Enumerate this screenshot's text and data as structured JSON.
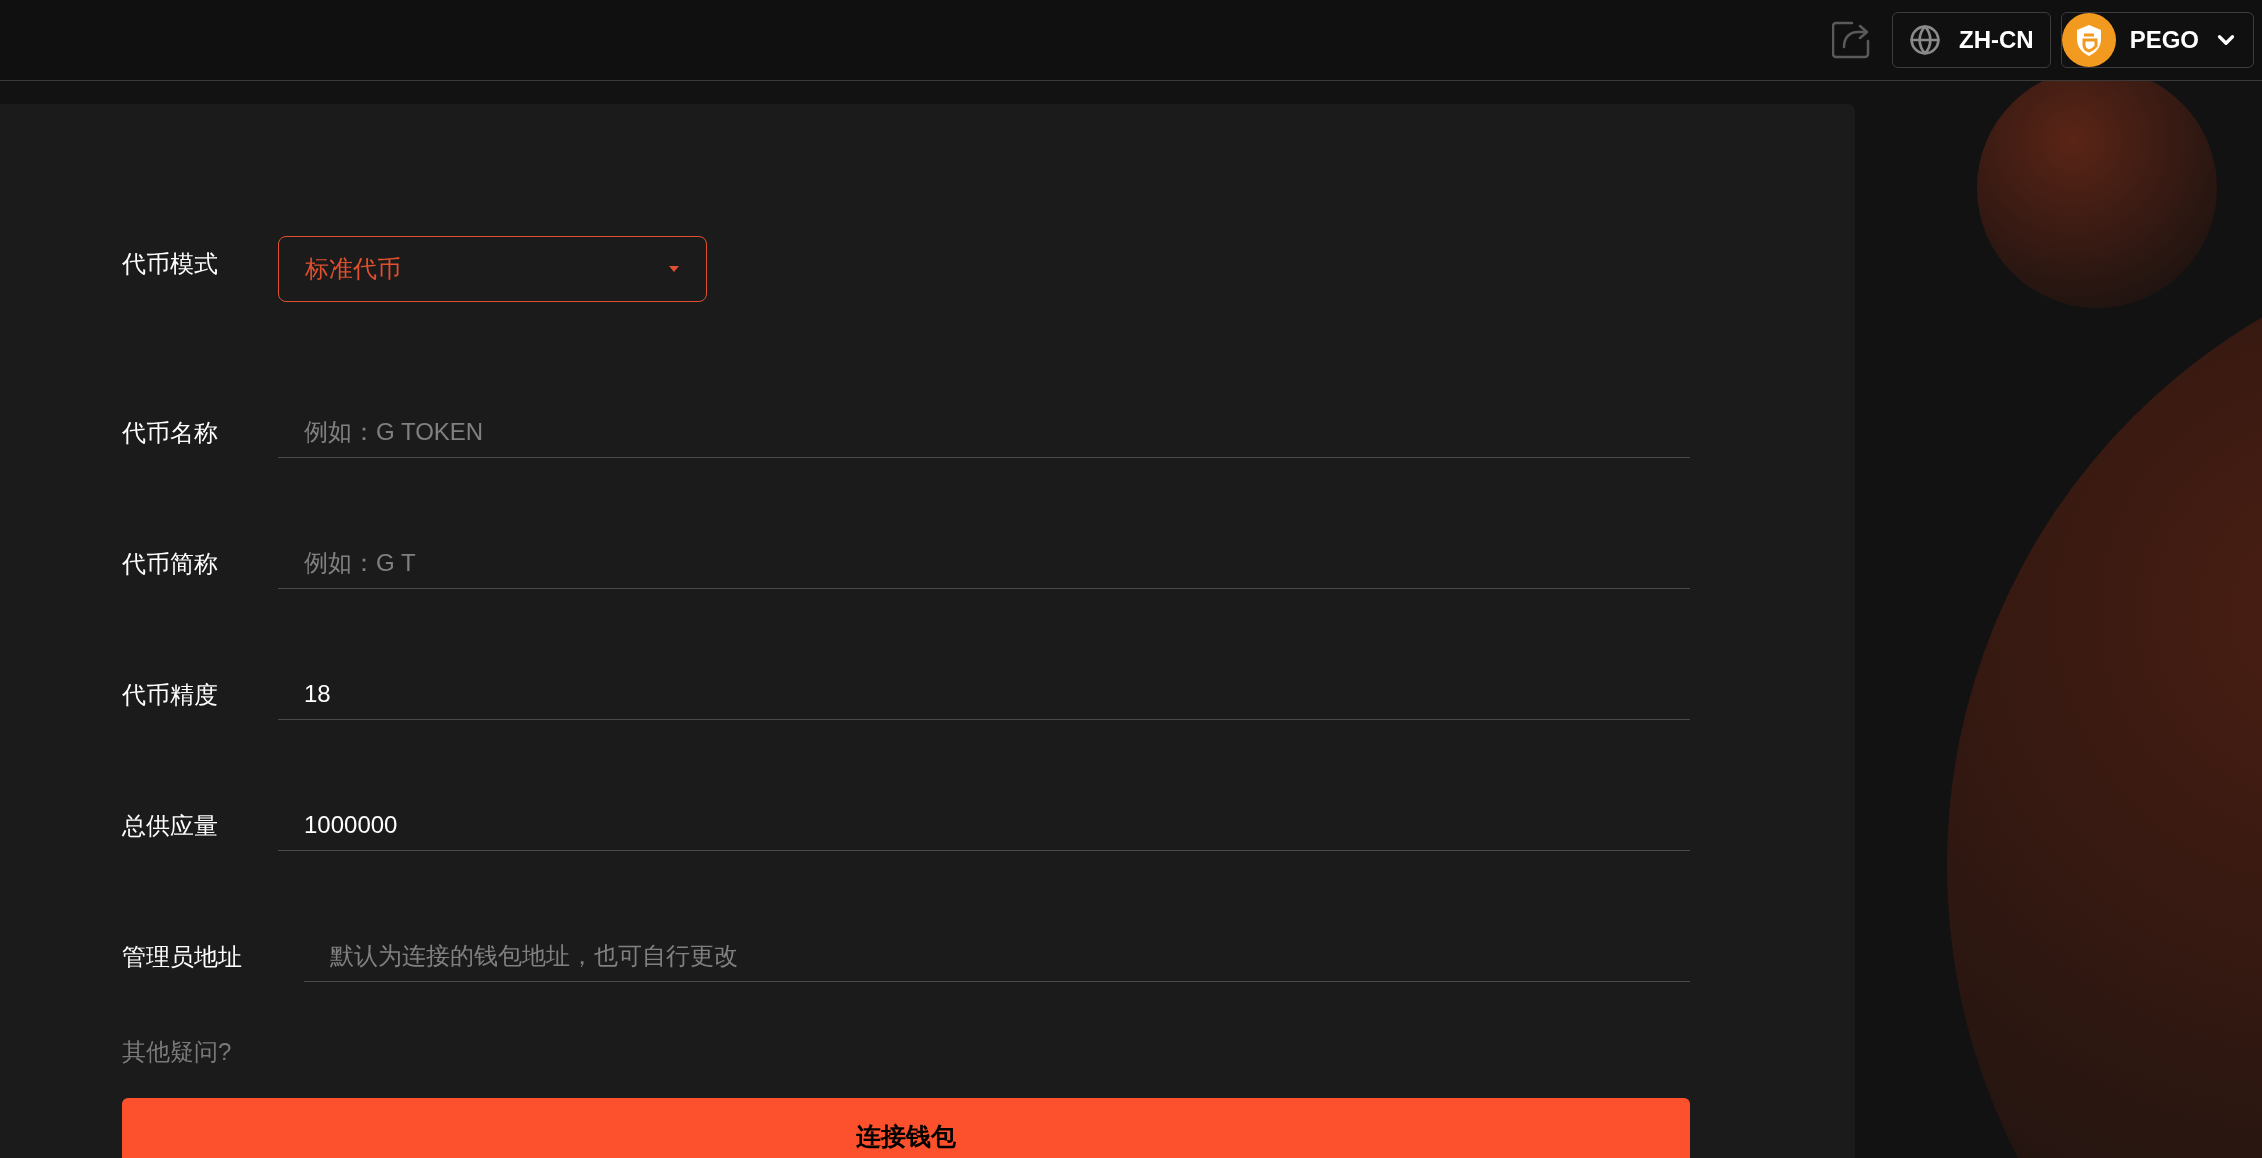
{
  "header": {
    "language": "ZH-CN",
    "account": "PEGO"
  },
  "form": {
    "fields": [
      {
        "kind": "select",
        "label": "代币模式",
        "value": "标准代币"
      },
      {
        "kind": "input",
        "label": "代币名称",
        "placeholder": "例如：G TOKEN"
      },
      {
        "kind": "input",
        "label": "代币简称",
        "placeholder": "例如：G T"
      },
      {
        "kind": "input",
        "label": "代币精度",
        "value": "18"
      },
      {
        "kind": "input",
        "label": "总供应量",
        "value": "1000000"
      },
      {
        "kind": "input",
        "label": "管理员地址",
        "placeholder": "默认为连接的钱包地址，也可自行更改"
      }
    ],
    "help_link": "其他疑问?",
    "submit": "连接钱包"
  }
}
